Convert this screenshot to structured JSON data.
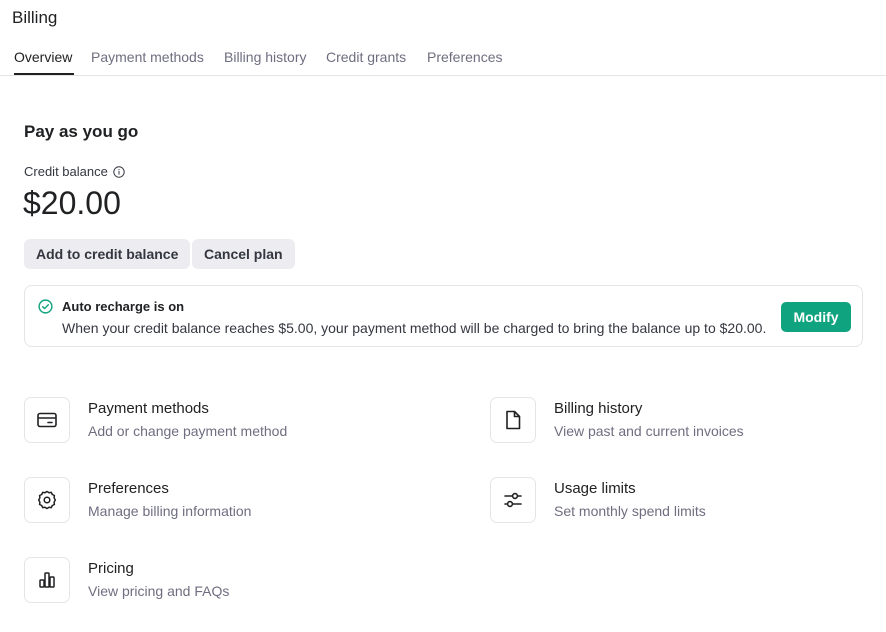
{
  "header": {
    "title": "Billing"
  },
  "tabs": [
    {
      "label": "Overview",
      "active": true
    },
    {
      "label": "Payment methods",
      "active": false
    },
    {
      "label": "Billing history",
      "active": false
    },
    {
      "label": "Credit grants",
      "active": false
    },
    {
      "label": "Preferences",
      "active": false
    }
  ],
  "plan": {
    "title": "Pay as you go",
    "balance_label": "Credit balance",
    "balance_value": "$20.00",
    "add_button": "Add to credit balance",
    "cancel_button": "Cancel plan"
  },
  "auto_recharge": {
    "title": "Auto recharge is on",
    "description": "When your credit balance reaches $5.00, your payment method will be charged to bring the balance up to $20.00.",
    "modify_button": "Modify"
  },
  "links": [
    {
      "title": "Payment methods",
      "subtitle": "Add or change payment method",
      "icon": "credit-card-icon"
    },
    {
      "title": "Billing history",
      "subtitle": "View past and current invoices",
      "icon": "document-icon"
    },
    {
      "title": "Preferences",
      "subtitle": "Manage billing information",
      "icon": "gear-icon"
    },
    {
      "title": "Usage limits",
      "subtitle": "Set monthly spend limits",
      "icon": "sliders-icon"
    },
    {
      "title": "Pricing",
      "subtitle": "View pricing and FAQs",
      "icon": "bar-chart-icon"
    }
  ],
  "colors": {
    "accent": "#10a37f",
    "text": "#202123",
    "muted": "#6e6e80",
    "button_gray": "#ececf1",
    "border": "#e5e5e5"
  }
}
